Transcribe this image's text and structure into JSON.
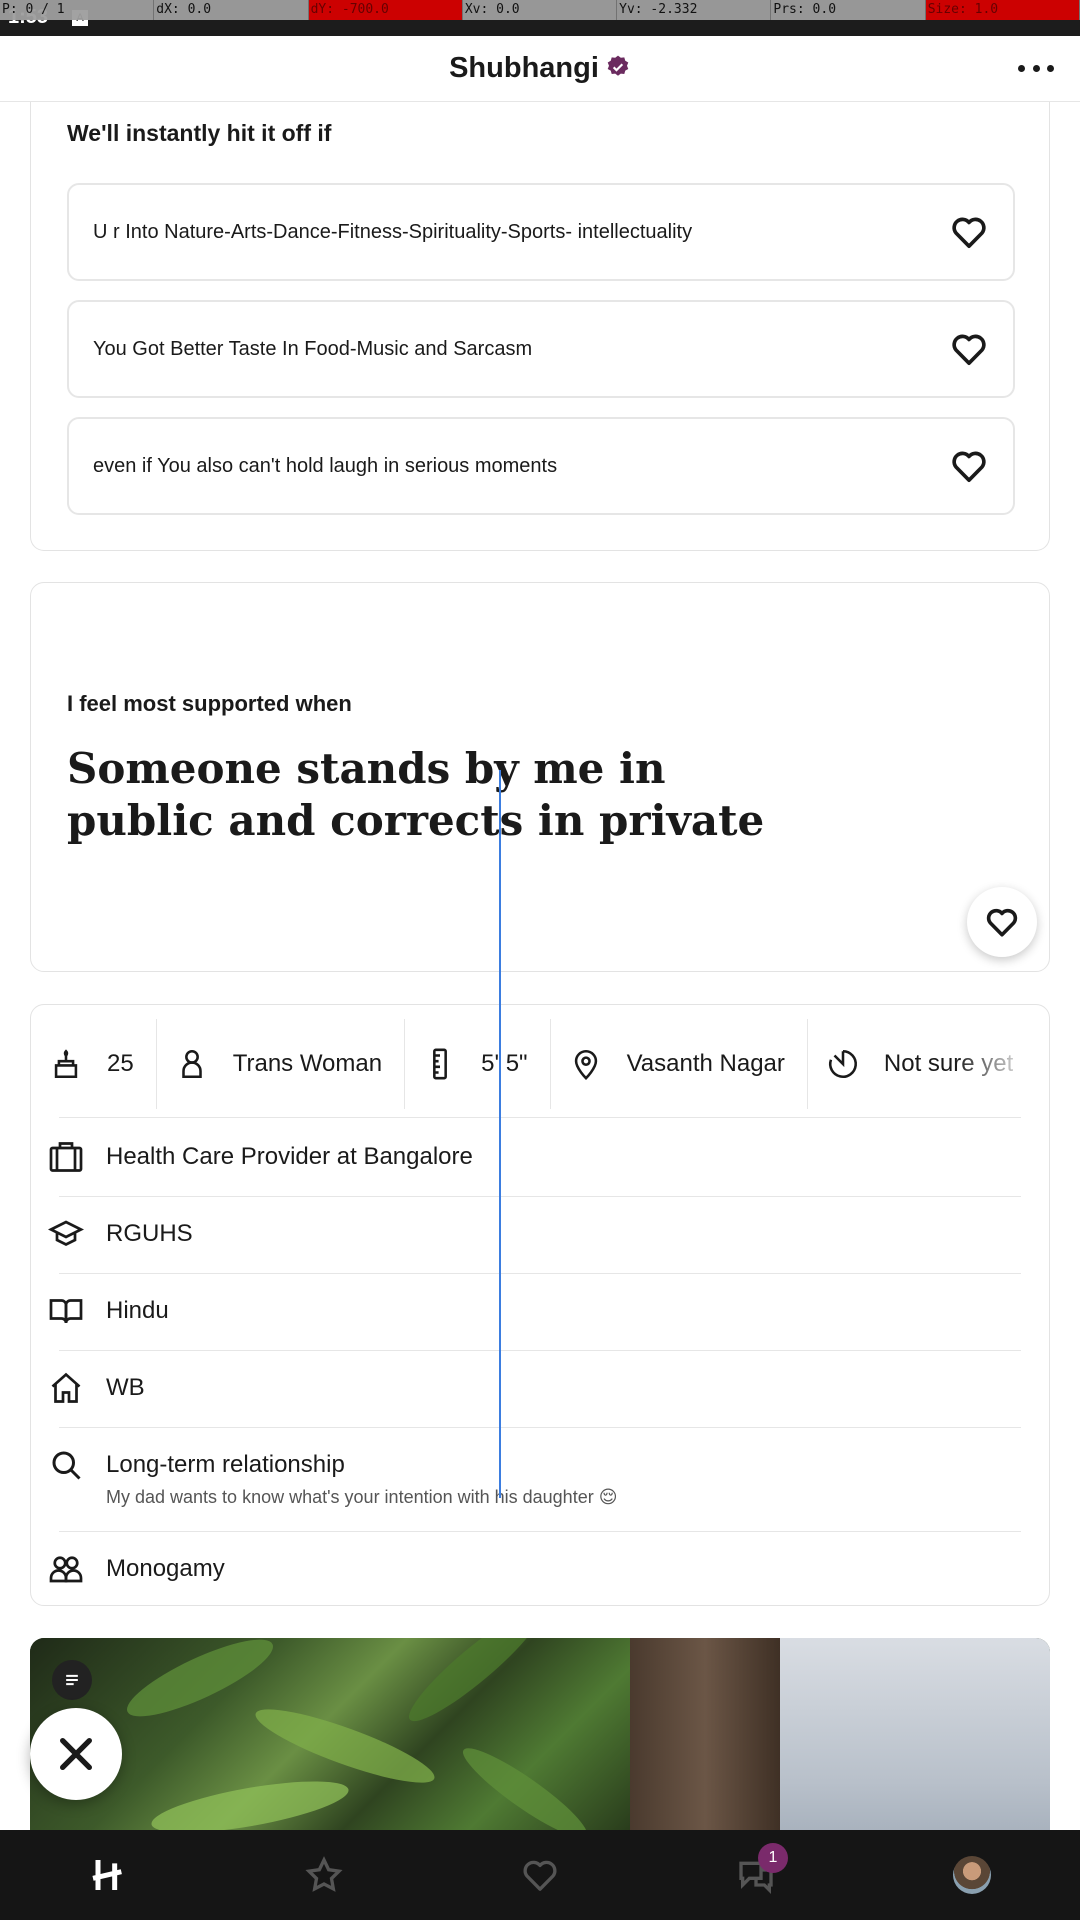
{
  "status": {
    "time": "1:53",
    "indicator": "A"
  },
  "debug": [
    "P: 0 / 1",
    "dX: 0.0",
    "dY: -700.0",
    "Xv: 0.0",
    "Yv: -2.332",
    "Prs: 0.0",
    "Size: 1.0"
  ],
  "header": {
    "name": "Shubhangi",
    "verified_color": "#6b2b5f"
  },
  "hit_it_off": {
    "title": "We'll instantly hit it off if",
    "items": [
      "U r Into Nature-Arts-Dance-Fitness-Spirituality-Sports- intellectuality",
      "You Got Better Taste In Food-Music and Sarcasm",
      "even if You also can't hold laugh in serious moments"
    ]
  },
  "prompt": {
    "question": "I feel most supported when",
    "answer": "Someone stands by me in public and corrects in private"
  },
  "vitals": {
    "age": "25",
    "gender": "Trans Woman",
    "height": "5' 5\"",
    "location": "Vasanth Nagar",
    "family_plans": "Not sure yet"
  },
  "details": {
    "work": "Health Care Provider  at Bangalore",
    "school": "RGUHS",
    "religion": "Hindu",
    "hometown": "WB",
    "intention": "Long-term relationship",
    "intention_note": "My dad wants to know what's your intention with his daughter 😌",
    "relationship_type": "Monogamy"
  },
  "nav": {
    "messages_badge": "1"
  },
  "colors": {
    "accent": "#6b2b5f",
    "nav_bg": "#151515",
    "trace": "#3b7de0"
  }
}
